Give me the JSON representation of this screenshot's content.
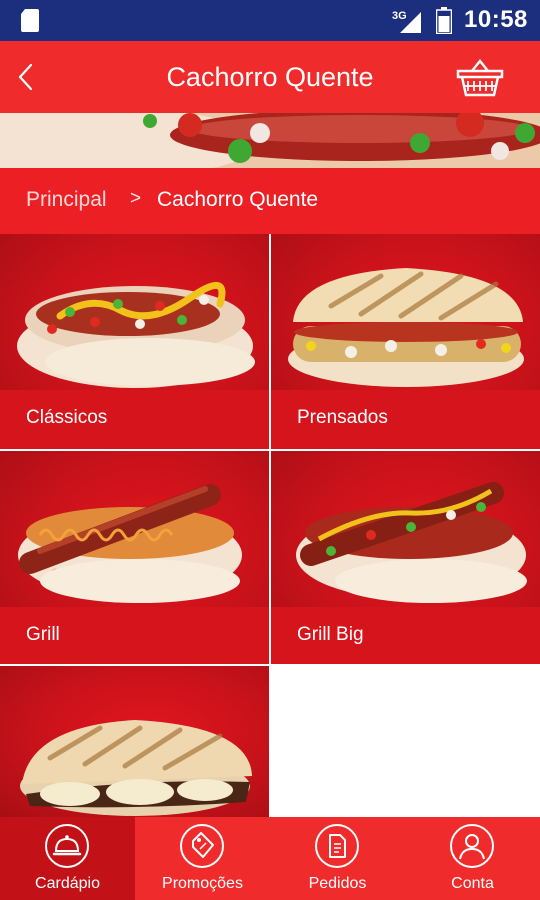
{
  "status_bar": {
    "network": "3G",
    "time": "10:58",
    "icons": [
      "sd-card-icon",
      "signal-icon",
      "battery-icon"
    ]
  },
  "app_bar": {
    "title": "Cachorro Quente",
    "icons": [
      "back-arrow-icon",
      "basket-icon"
    ]
  },
  "breadcrumb": {
    "home": "Principal",
    "separator": ">",
    "current": "Cachorro Quente"
  },
  "categories": [
    {
      "label": "Clássicos"
    },
    {
      "label": "Prensados"
    },
    {
      "label": "Grill"
    },
    {
      "label": "Grill Big"
    },
    {
      "label": ""
    }
  ],
  "tabs": [
    {
      "label": "Cardápio",
      "icon": "cloche-icon",
      "active": true
    },
    {
      "label": "Promoções",
      "icon": "price-tag-icon",
      "active": false
    },
    {
      "label": "Pedidos",
      "icon": "document-icon",
      "active": false
    },
    {
      "label": "Conta",
      "icon": "user-icon",
      "active": false
    }
  ],
  "colors": {
    "status_bar": "#1c2f7f",
    "app_bar": "#ef2b2b",
    "tile": "#d5141c",
    "active_tab": "#c21217"
  }
}
